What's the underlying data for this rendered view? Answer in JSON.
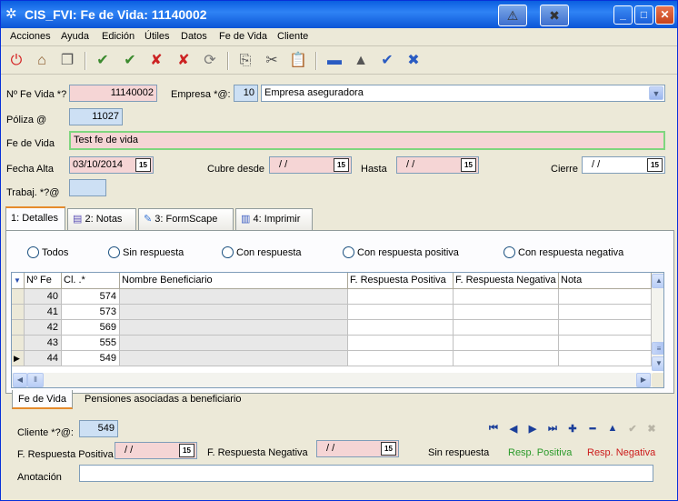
{
  "window": {
    "title": "CIS_FVI: Fe de Vida: 11140002"
  },
  "menu": [
    "Acciones",
    "Ayuda",
    "Edición",
    "Útiles",
    "Datos",
    "Fe de Vida",
    "Cliente"
  ],
  "form": {
    "nfevida_label": "Nº Fe Vida *?",
    "nfevida_value": "11140002",
    "empresa_label": "Empresa *@:",
    "empresa_code": "10",
    "empresa_name": "Empresa aseguradora",
    "poliza_label": "Póliza @",
    "poliza_value": "11027",
    "fevida_label": "Fe de Vida",
    "fevida_value": "Test fe de vida",
    "fecha_alta_label": "Fecha Alta",
    "fecha_alta_value": "03/10/2014",
    "cubre_desde_label": "Cubre desde",
    "cubre_desde_value": "/ /",
    "hasta_label": "Hasta",
    "hasta_value": "/ /",
    "cierre_label": "Cierre",
    "cierre_value": "/ /",
    "trabaj_label": "Trabaj. *?@",
    "trabaj_value": ""
  },
  "tabs": [
    "1: Detalles",
    "2: Notas",
    "3: FormScape",
    "4: Imprimir"
  ],
  "filters": [
    "Todos",
    "Sin respuesta",
    "Con respuesta",
    "Con respuesta positiva",
    "Con respuesta negativa"
  ],
  "grid": {
    "columns": [
      "Nº Fe",
      "Cl. .*",
      "Nombre Beneficiario",
      "F. Respuesta Positiva",
      "F. Respuesta Negativa",
      "Nota"
    ],
    "rows": [
      {
        "nfe": "40",
        "cl": "574"
      },
      {
        "nfe": "41",
        "cl": "573"
      },
      {
        "nfe": "42",
        "cl": "569"
      },
      {
        "nfe": "43",
        "cl": "555"
      },
      {
        "nfe": "44",
        "cl": "549"
      }
    ]
  },
  "bottom_tabs": [
    "Fe de Vida",
    "Pensiones asociadas a beneficiario"
  ],
  "detail": {
    "cliente_label": "Cliente *?@:",
    "cliente_value": "549",
    "fpos_label": "F. Respuesta Positiva",
    "fpos_value": "/ /",
    "fneg_label": "F. Respuesta Negativa",
    "fneg_value": "/ /",
    "legend_sin": "Sin respuesta",
    "legend_pos": "Resp. Positiva",
    "legend_neg": "Resp. Negativa",
    "anotacion_label": "Anotación",
    "anotacion_value": ""
  },
  "date_icon": "15",
  "colors": {
    "positive": "#2a9a2a",
    "negative": "#cc1b1b",
    "required_field": "#f5d5d5",
    "key_field": "#cde0f4"
  }
}
